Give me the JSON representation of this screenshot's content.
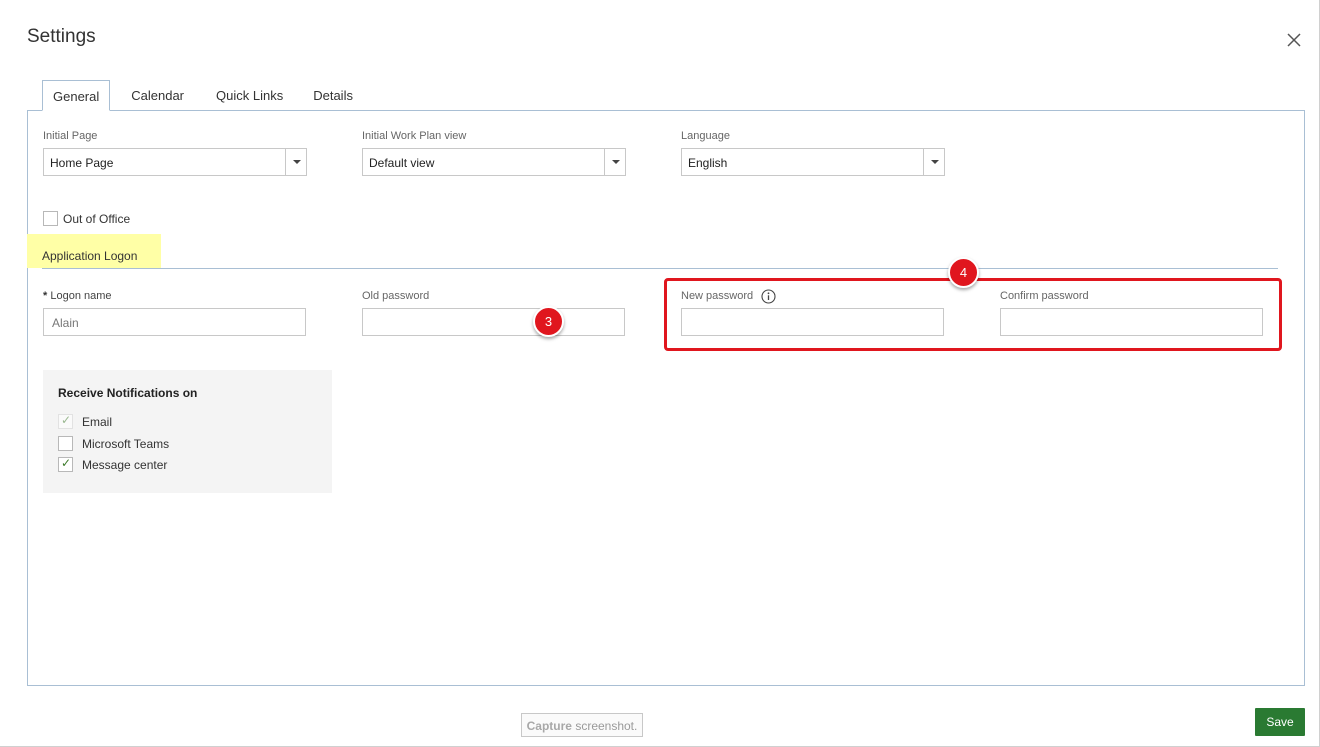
{
  "dialog": {
    "title": "Settings",
    "close_icon": "close-icon"
  },
  "tabs": [
    {
      "label": "General",
      "active": true
    },
    {
      "label": "Calendar",
      "active": false
    },
    {
      "label": "Quick Links",
      "active": false
    },
    {
      "label": "Details",
      "active": false
    }
  ],
  "general": {
    "initial_page": {
      "label": "Initial Page",
      "value": "Home Page"
    },
    "work_plan_view": {
      "label": "Initial Work Plan view",
      "value": "Default view"
    },
    "language": {
      "label": "Language",
      "value": "English"
    },
    "out_of_office": {
      "label": "Out of Office",
      "checked": false
    }
  },
  "logon": {
    "section_title": "Application Logon",
    "required_marker": "*",
    "logon_name": {
      "label": "Logon name",
      "value": "Alain"
    },
    "old_password": {
      "label": "Old password",
      "value": ""
    },
    "new_password": {
      "label": "New password",
      "value": "",
      "info_icon": "info-icon"
    },
    "confirm_password": {
      "label": "Confirm password",
      "value": ""
    }
  },
  "notifications": {
    "title": "Receive Notifications on",
    "options": [
      {
        "label": "Email",
        "checked": true,
        "disabled": true
      },
      {
        "label": "Microsoft Teams",
        "checked": false,
        "disabled": false
      },
      {
        "label": "Message center",
        "checked": true,
        "disabled": false
      }
    ]
  },
  "annotations": {
    "badge_3": "3",
    "badge_4": "4",
    "highlight_color": "#e0161e"
  },
  "footer": {
    "capture_bold": "Capture",
    "capture_rest": " screenshot.",
    "save_label": "Save",
    "save_color": "#2a7a32"
  }
}
